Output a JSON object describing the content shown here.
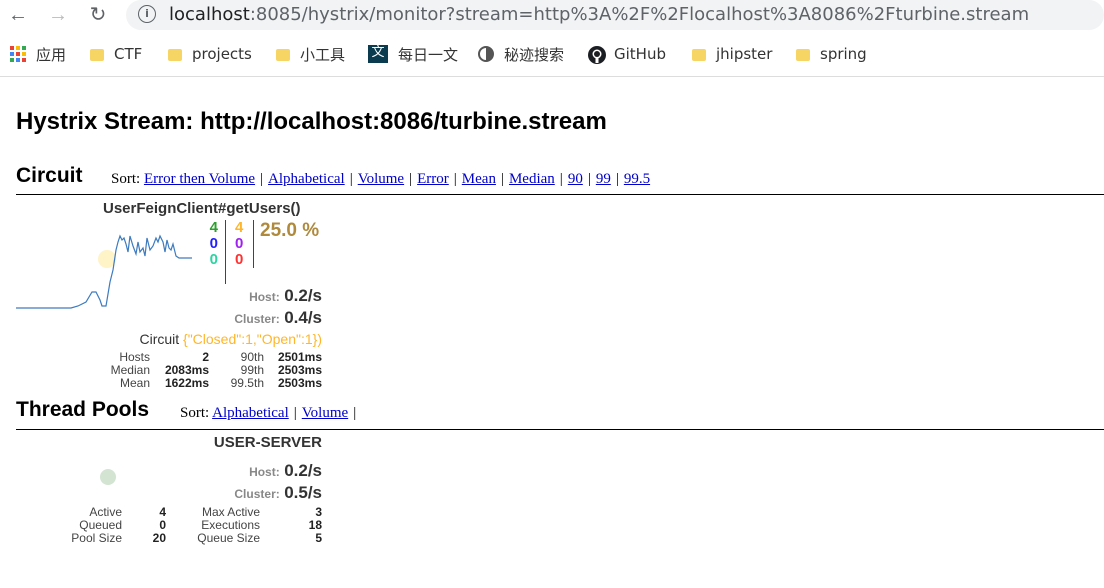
{
  "browser": {
    "url_host": "localhost",
    "url_rest": ":8085/hystrix/monitor?stream=http%3A%2F%2Flocalhost%3A8086%2Fturbine.stream",
    "bookmarks": [
      "应用",
      "CTF",
      "projects",
      "小工具",
      "每日一文",
      "秘迹搜索",
      "GitHub",
      "jhipster",
      "spring"
    ]
  },
  "page": {
    "title": "Hystrix Stream: http://localhost:8086/turbine.stream"
  },
  "circuit": {
    "heading": "Circuit",
    "sort_label": "Sort:",
    "sort_links": [
      "Error then Volume",
      "Alphabetical",
      "Volume",
      "Error",
      "Mean",
      "Median",
      "90",
      "99",
      "99.5"
    ],
    "name": "UserFeignClient#getUsers()",
    "counts_left": [
      "4",
      "0",
      "0"
    ],
    "counts_right": [
      "4",
      "0",
      "0"
    ],
    "error_pct": "25.0 %",
    "host_label": "Host:",
    "host_rate": "0.2/s",
    "cluster_label": "Cluster:",
    "cluster_rate": "0.4/s",
    "circuit_label": "Circuit",
    "circuit_status": "{\"Closed\":1,\"Open\":1})",
    "stats": {
      "hosts_label": "Hosts",
      "hosts": "2",
      "median_label": "Median",
      "median": "2083ms",
      "mean_label": "Mean",
      "mean": "1622ms",
      "p90_label": "90th",
      "p90": "2501ms",
      "p99_label": "99th",
      "p99": "2503ms",
      "p995_label": "99.5th",
      "p995": "2503ms"
    },
    "colors": {
      "green": "#2ca02c",
      "blue": "#1f1fff",
      "teal": "#2bd4a0",
      "orange": "#ffb62a",
      "purple": "#a020f0",
      "red": "#ff3030",
      "brown": "#b08a3c"
    }
  },
  "thread_pools": {
    "heading": "Thread Pools",
    "sort_label": "Sort:",
    "sort_links": [
      "Alphabetical",
      "Volume"
    ],
    "name": "USER-SERVER",
    "host_label": "Host:",
    "host_rate": "0.2/s",
    "cluster_label": "Cluster:",
    "cluster_rate": "0.5/s",
    "stats": {
      "active_label": "Active",
      "active": "4",
      "queued_label": "Queued",
      "queued": "0",
      "pool_size_label": "Pool Size",
      "pool_size": "20",
      "max_active_label": "Max Active",
      "max_active": "3",
      "executions_label": "Executions",
      "executions": "18",
      "queue_size_label": "Queue Size",
      "queue_size": "5"
    }
  }
}
